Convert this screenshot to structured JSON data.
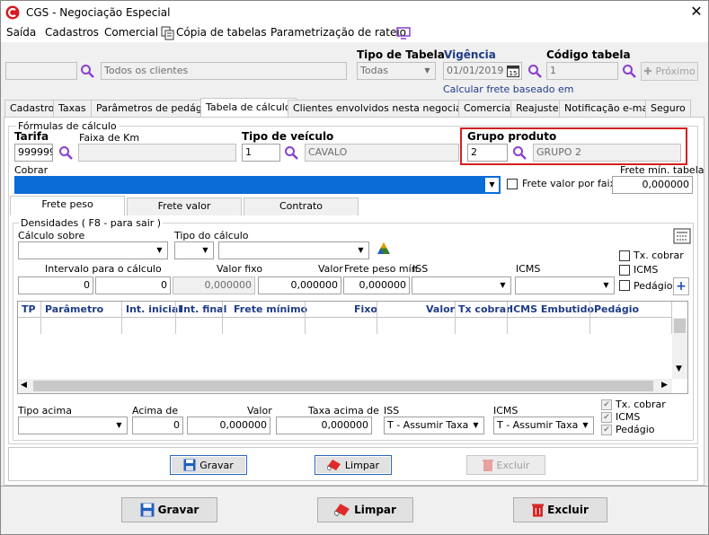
{
  "window": {
    "title": "CGS - Negociação Especial",
    "close": "✕"
  },
  "menu": [
    "Saída",
    "Cadastros",
    "Comercial",
    "Cópia de tabelas",
    "Parametrização de rateio"
  ],
  "top": {
    "client_code": "",
    "client_name": "Todos os clientes",
    "tipo_tabela_label": "Tipo de Tabela",
    "tipo_tabela_value": "Todas",
    "vigencia_label": "Vigência",
    "vigencia_value": "01/01/2019",
    "codigo_tabela_label": "Código tabela",
    "codigo_tabela_value": "1",
    "proximo_label": "Próximo",
    "calc_link": "Calcular frete baseado em"
  },
  "tabs": [
    "Cadastro",
    "Taxas",
    "Parâmetros de pedágio",
    "Tabela de cálculo",
    "Clientes envolvidos nesta negociação",
    "Comercial",
    "Reajuste",
    "Notificação e-mail",
    "Seguro"
  ],
  "calc": {
    "formulas_label": "Fórmulas de cálculo",
    "tarifa_label": "Tarifa",
    "tarifa_value": "999999",
    "faixa_km_label": "Faixa de Km",
    "faixa_km_value": "",
    "tipo_veiculo_label": "Tipo de veículo",
    "tipo_veiculo_code": "1",
    "tipo_veiculo_name": "CAVALO",
    "grupo_label": "Grupo produto",
    "grupo_code": "2",
    "grupo_name": "GRUPO 2",
    "cobrar_label": "Cobrar",
    "frete_valor_faixas": "Frete valor por faixas",
    "frete_min_label": "Frete mín. tabela",
    "frete_min_value": "0,000000"
  },
  "subtabs": [
    "Frete peso",
    "Frete valor",
    "Contrato"
  ],
  "dens": {
    "group_label": "Densidades ( F8 - para sair )",
    "calculo_sobre": "Cálculo sobre",
    "tipo_calculo": "Tipo do cálculo",
    "tx_cobrar": "Tx. cobrar",
    "icms": "ICMS",
    "pedagio": "Pedágio",
    "intervalo_label": "Intervalo para o cálculo",
    "int_ini": "0",
    "int_fim": "0",
    "valor_fixo_label": "Valor fixo",
    "valor_fixo": "0,000000",
    "valor_label": "Valor",
    "valor": "0,000000",
    "frete_peso_min_label": "Frete peso mín.",
    "frete_peso_min": "0,000000",
    "iss_label": "ISS",
    "icms_label": "ICMS"
  },
  "grid_cols": [
    "TP",
    "Parâmetro",
    "Int. inicial",
    "Int. final",
    "Frete mínimo",
    "Fixo",
    "Valor",
    "Tx cobrar",
    "ICMS Embutido",
    "Pedágio"
  ],
  "bottom": {
    "tipo_acima": "Tipo acima",
    "acima_de": "Acima de",
    "acima_de_value": "0",
    "valor_label": "Valor",
    "valor_value": "0,000000",
    "taxa_acima_label": "Taxa acima de",
    "taxa_acima_value": "0,000000",
    "iss_label": "ISS",
    "iss_value": "T - Assumir Taxa",
    "icms_label": "ICMS",
    "icms_value": "T - Assumir Taxa",
    "tx_cobrar": "Tx. cobrar",
    "icms": "ICMS",
    "pedagio": "Pedágio"
  },
  "inner_buttons": {
    "gravar": "Gravar",
    "limpar": "Limpar",
    "excluir": "Excluir"
  },
  "outer_buttons": {
    "gravar": "Gravar",
    "limpar": "Limpar",
    "excluir": "Excluir"
  },
  "colors": {
    "highlight_red": "#d42020",
    "cobrar_blue": "#0a6cd6",
    "grid_header_text": "#1f3c88",
    "magnifier": "#8b3fcf"
  }
}
